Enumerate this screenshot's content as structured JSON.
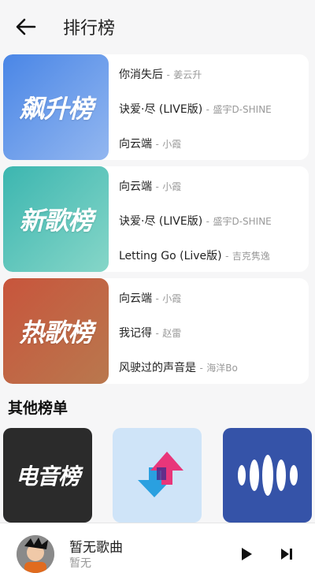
{
  "header": {
    "title": "排行榜"
  },
  "charts": [
    {
      "cover_label": "飙升榜",
      "songs": [
        {
          "name": "你消失后",
          "artist": "姜云升"
        },
        {
          "name": "诀爱·尽 (LIVE版)",
          "artist": "盛宇D-SHINE"
        },
        {
          "name": "向云端",
          "artist": "小霞"
        }
      ]
    },
    {
      "cover_label": "新歌榜",
      "songs": [
        {
          "name": "向云端",
          "artist": "小霞"
        },
        {
          "name": "诀爱·尽 (LIVE版)",
          "artist": "盛宇D-SHINE"
        },
        {
          "name": "Letting Go (Live版)",
          "artist": "吉克隽逸"
        }
      ]
    },
    {
      "cover_label": "热歌榜",
      "songs": [
        {
          "name": "向云端",
          "artist": "小霞"
        },
        {
          "name": "我记得",
          "artist": "赵雷"
        },
        {
          "name": "风驶过的声音是",
          "artist": "海洋Bo"
        }
      ]
    }
  ],
  "separator": "-",
  "other": {
    "title": "其他榜单",
    "tiles": [
      {
        "label": "电音榜",
        "icon": "electronic-chart-cover"
      },
      {
        "label": "",
        "icon": "up-down-arrows-icon"
      },
      {
        "label": "",
        "icon": "sound-wave-icon"
      }
    ]
  },
  "player": {
    "title": "暂无歌曲",
    "subtitle": "暂无"
  },
  "colors": {
    "surge": [
      "#4a86e6",
      "#8fb0ef"
    ],
    "new": [
      "#3cb6b0",
      "#86d6c8"
    ],
    "hot": [
      "#c8553c",
      "#b9784e"
    ],
    "electronic": "#2b2b2b",
    "arrows_bg": "#cfe4f8",
    "wave_bg": "#3553a8"
  }
}
